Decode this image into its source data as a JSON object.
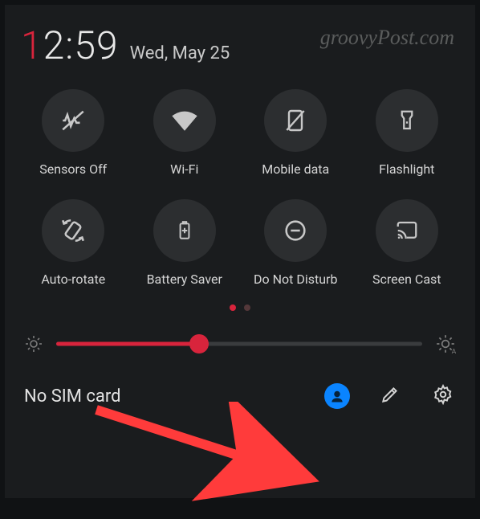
{
  "clock": {
    "leading": "1",
    "rest": "2:59"
  },
  "date": "Wed, May 25",
  "watermark": "groovyPost.com",
  "tiles": [
    {
      "label": "Sensors Off"
    },
    {
      "label": "Wi-Fi"
    },
    {
      "label": "Mobile data"
    },
    {
      "label": "Flashlight"
    },
    {
      "label": "Auto-rotate"
    },
    {
      "label": "Battery Saver"
    },
    {
      "label": "Do Not Disturb"
    },
    {
      "label": "Screen Cast"
    }
  ],
  "slider": {
    "value_pct": 39
  },
  "status": "No SIM card",
  "colors": {
    "accent": "#d8243c",
    "avatar": "#0a84ff"
  }
}
